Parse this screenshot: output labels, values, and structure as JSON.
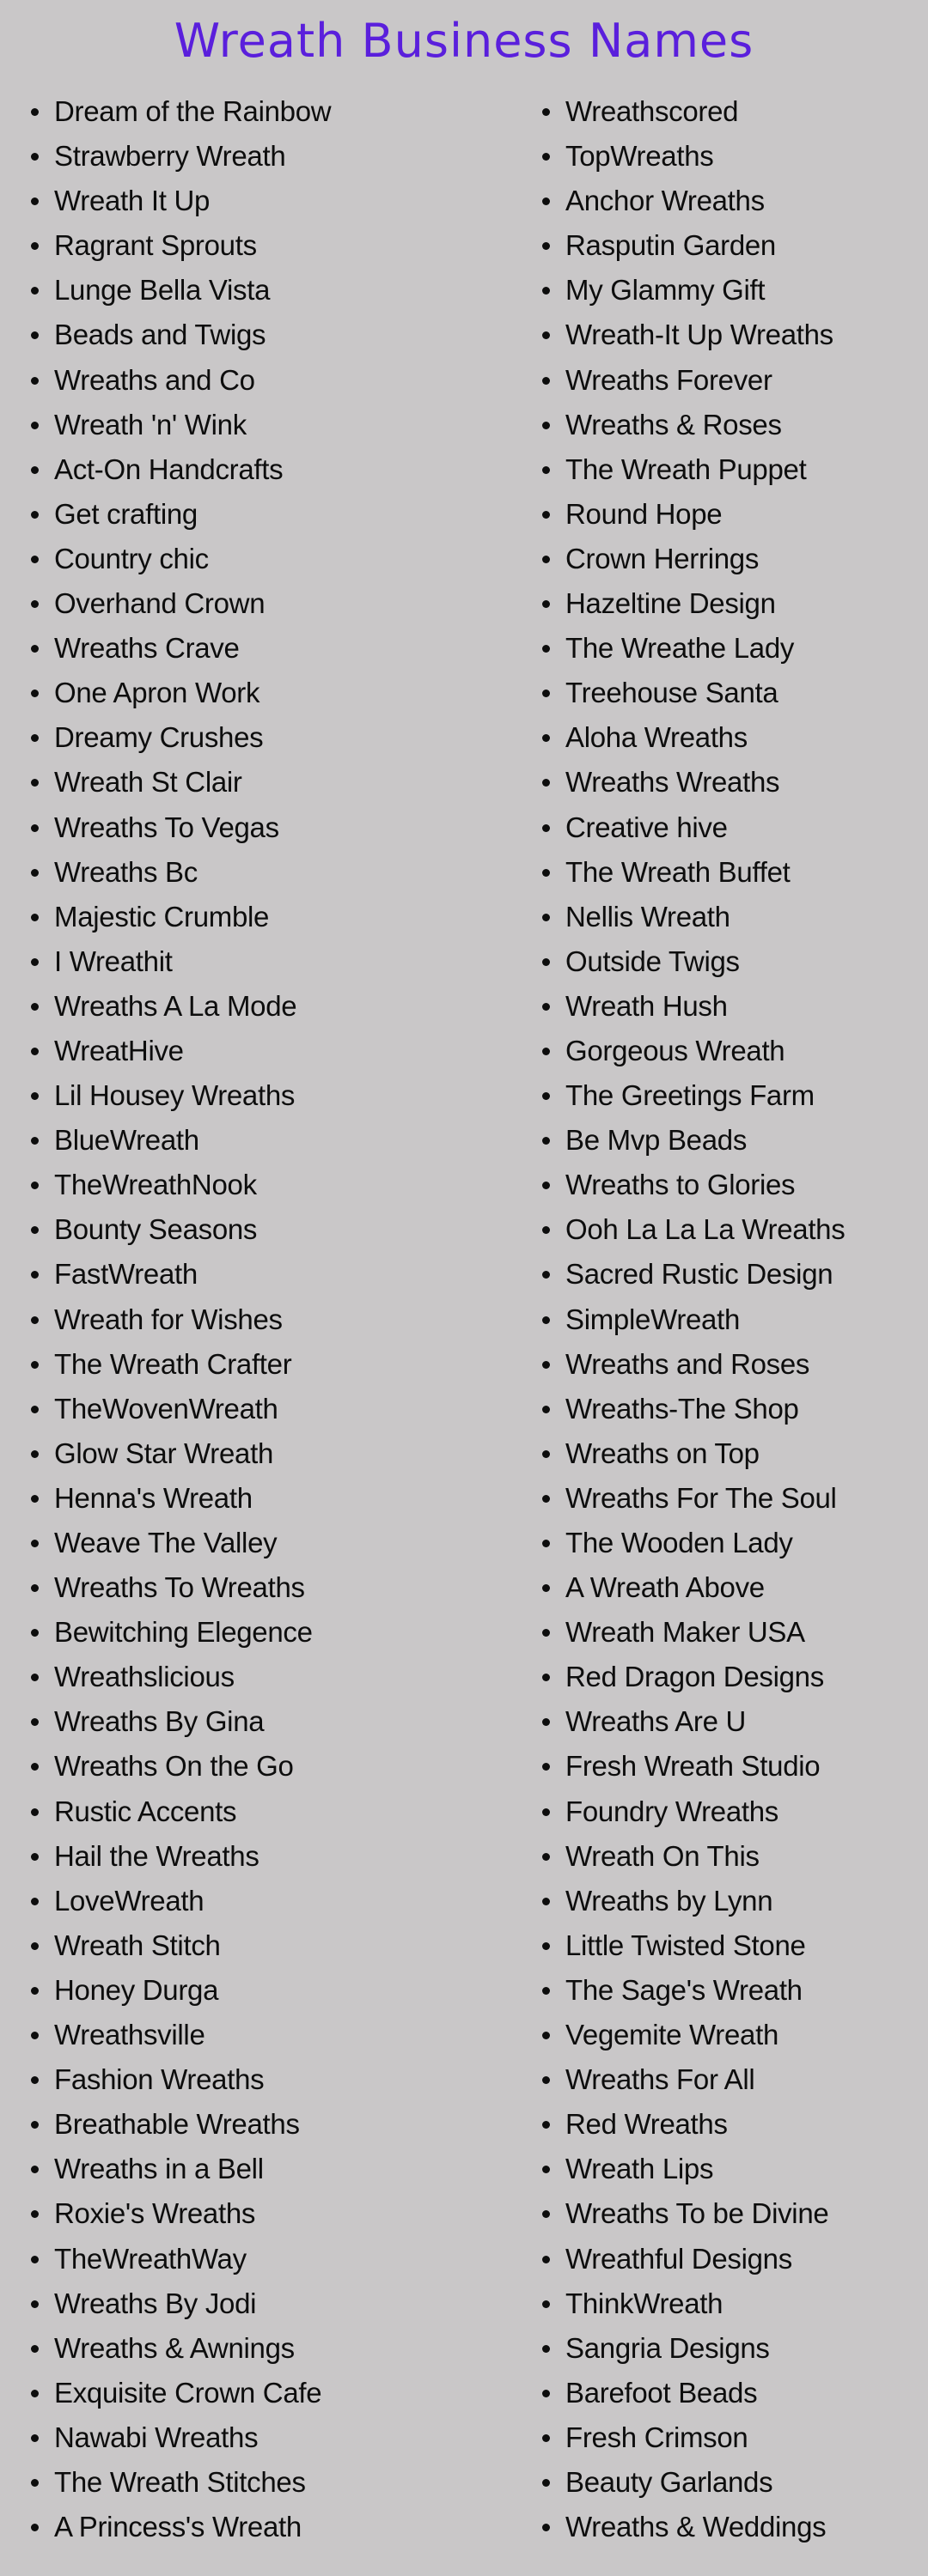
{
  "page": {
    "title": "Wreath Business Names",
    "colors": {
      "background": "#c9c7c8",
      "title": "#5a1fdc",
      "text": "#0d0d0d"
    }
  },
  "columns": {
    "left": [
      "Dream of the Rainbow",
      "Strawberry Wreath",
      "Wreath It Up",
      "Ragrant Sprouts",
      "Lunge Bella Vista",
      "Beads and Twigs",
      "Wreaths and Co",
      "Wreath 'n' Wink",
      "Act-On Handcrafts",
      "Get crafting",
      "Country chic",
      "Overhand Crown",
      "Wreaths Crave",
      "One Apron Work",
      "Dreamy Crushes",
      "Wreath St Clair",
      "Wreaths To Vegas",
      "Wreaths Bc",
      "Majestic Crumble",
      "I Wreathit",
      "Wreaths A La Mode",
      "WreatHive",
      "Lil Housey Wreaths",
      "BlueWreath",
      "TheWreathNook",
      "Bounty Seasons",
      "FastWreath",
      "Wreath for Wishes",
      "The Wreath Crafter",
      "TheWovenWreath",
      "Glow Star Wreath",
      "Henna's Wreath",
      "Weave The Valley",
      "Wreaths To Wreaths",
      "Bewitching Elegence",
      "Wreathslicious",
      "Wreaths By Gina",
      "Wreaths On the Go",
      "Rustic Accents",
      "Hail the Wreaths",
      "LoveWreath",
      "Wreath Stitch",
      "Honey Durga",
      "Wreathsville",
      "Fashion Wreaths",
      "Breathable Wreaths",
      "Wreaths in a Bell",
      "Roxie's Wreaths",
      "TheWreathWay",
      "Wreaths By Jodi",
      "Wreaths & Awnings",
      "Exquisite Crown Cafe",
      "Nawabi Wreaths",
      "The Wreath Stitches",
      "A Princess's Wreath"
    ],
    "right": [
      "Wreathscored",
      "TopWreaths",
      "Anchor Wreaths",
      "Rasputin Garden",
      "My Glammy Gift",
      "Wreath-It Up Wreaths",
      "Wreaths Forever",
      "Wreaths & Roses",
      "The Wreath Puppet",
      "Round Hope",
      "Crown Herrings",
      "Hazeltine Design",
      "The Wreathe Lady",
      "Treehouse Santa",
      "Aloha Wreaths",
      "Wreaths Wreaths",
      "Creative hive",
      "The Wreath Buffet",
      "Nellis Wreath",
      "Outside Twigs",
      "Wreath Hush",
      "Gorgeous Wreath",
      "The Greetings Farm",
      "Be Mvp Beads",
      "Wreaths to Glories",
      "Ooh La La La Wreaths",
      "Sacred Rustic Design",
      "SimpleWreath",
      "Wreaths and Roses",
      "Wreaths-The Shop",
      "Wreaths on Top",
      "Wreaths For The Soul",
      "The Wooden Lady",
      "A Wreath Above",
      "Wreath Maker USA",
      "Red Dragon Designs",
      "Wreaths Are U",
      "Fresh Wreath Studio",
      "Foundry Wreaths",
      "Wreath On This",
      "Wreaths by Lynn",
      "Little Twisted Stone",
      "The Sage's Wreath",
      "Vegemite Wreath",
      "Wreaths For All",
      "Red Wreaths",
      "Wreath Lips",
      "Wreaths To be Divine",
      "Wreathful Designs",
      "ThinkWreath",
      "Sangria Designs",
      "Barefoot Beads",
      "Fresh Crimson",
      "Beauty Garlands",
      "Wreaths & Weddings"
    ]
  }
}
